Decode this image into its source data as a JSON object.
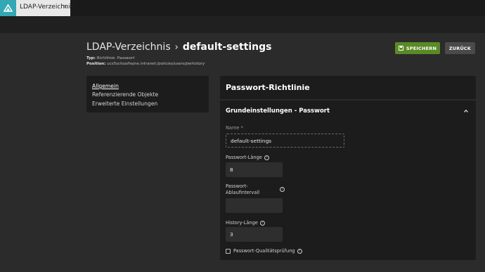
{
  "tab": {
    "label": "LDAP-Verzeichnis",
    "close": "×"
  },
  "header": {
    "breadcrumb_root": "LDAP-Verzeichnis",
    "separator": "›",
    "title": "default-settings",
    "type_label": "Typ:",
    "type_value": "Richtlinie: Passwort",
    "position_label": "Position:",
    "position_value": "ucs5schoolhejne.intranet:/policies/users/pwhistory"
  },
  "buttons": {
    "save": "SPEICHERN",
    "back": "ZURÜCK"
  },
  "nav": {
    "items": [
      {
        "label": "Allgemein",
        "active": true
      },
      {
        "label": "Referenzierende Objekte",
        "active": false
      },
      {
        "label": "Erweiterte Einstellungen",
        "active": false
      }
    ]
  },
  "panel": {
    "title": "Passwort-Richtlinie",
    "section_title": "Grundeinstellungen - Passwort",
    "fields": {
      "name_label": "Name *",
      "name_value": "default-settings",
      "length_label": "Passwort-Länge",
      "length_value": "8",
      "expiry_label_1": "Passwort-",
      "expiry_label_2": "Ablaufintervall",
      "expiry_value": "",
      "history_label": "History-Länge",
      "history_value": "3",
      "quality_label": "Passwort-Qualitätsprüfung",
      "quality_checked": false
    }
  },
  "colors": {
    "accent": "#32a8b4",
    "save": "#5a8a26",
    "background": "#2b2b2b",
    "panel": "#1c1c1c"
  },
  "icons": [
    "univention-logo-icon",
    "close-icon",
    "save-icon",
    "chevron-up-icon",
    "help-icon"
  ]
}
